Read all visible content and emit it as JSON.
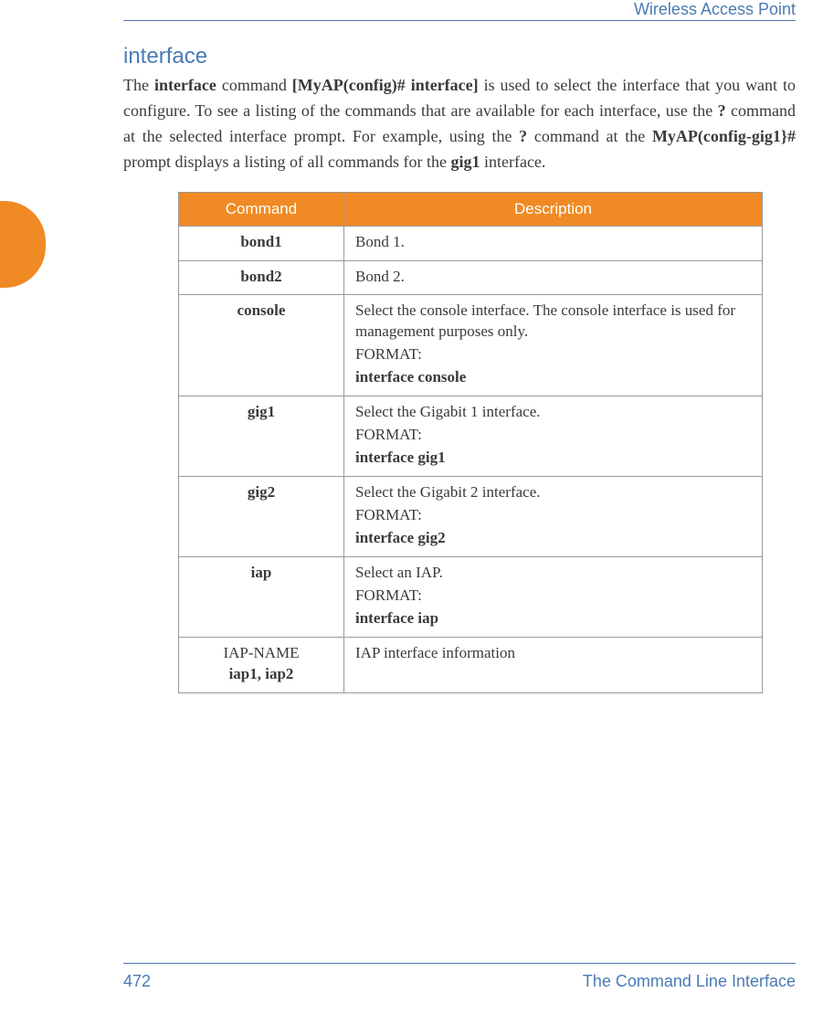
{
  "header": {
    "title": "Wireless Access Point"
  },
  "section": {
    "title": "interface"
  },
  "intro": {
    "t1": "The ",
    "b1": "interface",
    "t2": " command ",
    "b2": "[MyAP(config)# interface]",
    "t3": " is used to select the interface that you want to configure. To see a listing of the commands that are available for each interface, use the ",
    "b3": "?",
    "t4": " command at the selected interface prompt. For example, using the ",
    "b4": "?",
    "t5": " command at the ",
    "b5": "MyAP(config-gig1}#",
    "t6": " prompt displays a listing of all commands for the ",
    "b6": "gig1",
    "t7": " interface."
  },
  "table": {
    "headers": {
      "command": "Command",
      "description": "Description"
    },
    "rows": [
      {
        "cmd": "bond1",
        "desc": "Bond 1."
      },
      {
        "cmd": "bond2",
        "desc": "Bond 2."
      },
      {
        "cmd": "console",
        "desc": "Select the console interface. The console interface is used for management purposes only.",
        "format_label": "FORMAT:",
        "format": "interface console"
      },
      {
        "cmd": "gig1",
        "desc": "Select the Gigabit 1 interface.",
        "format_label": "FORMAT:",
        "format": "interface gig1"
      },
      {
        "cmd": "gig2",
        "desc": "Select the Gigabit 2 interface.",
        "format_label": "FORMAT:",
        "format": "interface gig2"
      },
      {
        "cmd": "iap",
        "desc": "Select an IAP.",
        "format_label": "FORMAT:",
        "format": "interface iap"
      },
      {
        "cmd_main": "IAP-NAME",
        "cmd_sub": "iap1, iap2",
        "desc": "IAP interface information"
      }
    ]
  },
  "footer": {
    "page": "472",
    "section": "The Command Line Interface"
  }
}
